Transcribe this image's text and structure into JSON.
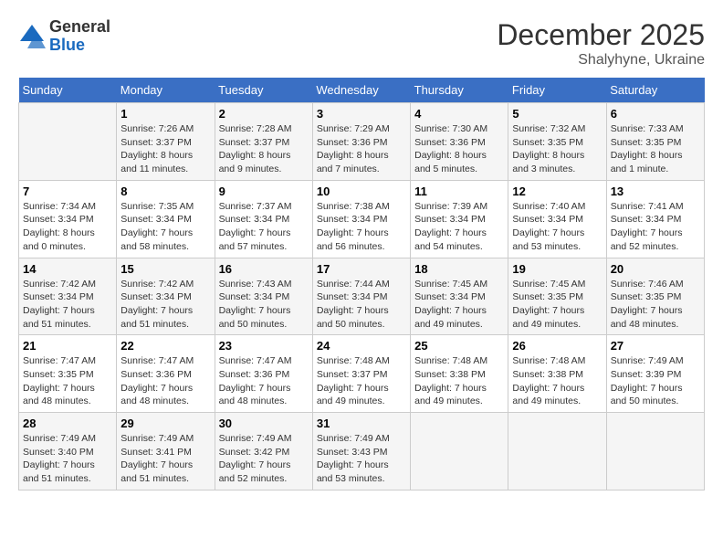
{
  "logo": {
    "general": "General",
    "blue": "Blue"
  },
  "header": {
    "month": "December 2025",
    "location": "Shalyhyne, Ukraine"
  },
  "weekdays": [
    "Sunday",
    "Monday",
    "Tuesday",
    "Wednesday",
    "Thursday",
    "Friday",
    "Saturday"
  ],
  "weeks": [
    [
      {
        "day": "",
        "sunrise": "",
        "sunset": "",
        "daylight": ""
      },
      {
        "day": "1",
        "sunrise": "Sunrise: 7:26 AM",
        "sunset": "Sunset: 3:37 PM",
        "daylight": "Daylight: 8 hours and 11 minutes."
      },
      {
        "day": "2",
        "sunrise": "Sunrise: 7:28 AM",
        "sunset": "Sunset: 3:37 PM",
        "daylight": "Daylight: 8 hours and 9 minutes."
      },
      {
        "day": "3",
        "sunrise": "Sunrise: 7:29 AM",
        "sunset": "Sunset: 3:36 PM",
        "daylight": "Daylight: 8 hours and 7 minutes."
      },
      {
        "day": "4",
        "sunrise": "Sunrise: 7:30 AM",
        "sunset": "Sunset: 3:36 PM",
        "daylight": "Daylight: 8 hours and 5 minutes."
      },
      {
        "day": "5",
        "sunrise": "Sunrise: 7:32 AM",
        "sunset": "Sunset: 3:35 PM",
        "daylight": "Daylight: 8 hours and 3 minutes."
      },
      {
        "day": "6",
        "sunrise": "Sunrise: 7:33 AM",
        "sunset": "Sunset: 3:35 PM",
        "daylight": "Daylight: 8 hours and 1 minute."
      }
    ],
    [
      {
        "day": "7",
        "sunrise": "Sunrise: 7:34 AM",
        "sunset": "Sunset: 3:34 PM",
        "daylight": "Daylight: 8 hours and 0 minutes."
      },
      {
        "day": "8",
        "sunrise": "Sunrise: 7:35 AM",
        "sunset": "Sunset: 3:34 PM",
        "daylight": "Daylight: 7 hours and 58 minutes."
      },
      {
        "day": "9",
        "sunrise": "Sunrise: 7:37 AM",
        "sunset": "Sunset: 3:34 PM",
        "daylight": "Daylight: 7 hours and 57 minutes."
      },
      {
        "day": "10",
        "sunrise": "Sunrise: 7:38 AM",
        "sunset": "Sunset: 3:34 PM",
        "daylight": "Daylight: 7 hours and 56 minutes."
      },
      {
        "day": "11",
        "sunrise": "Sunrise: 7:39 AM",
        "sunset": "Sunset: 3:34 PM",
        "daylight": "Daylight: 7 hours and 54 minutes."
      },
      {
        "day": "12",
        "sunrise": "Sunrise: 7:40 AM",
        "sunset": "Sunset: 3:34 PM",
        "daylight": "Daylight: 7 hours and 53 minutes."
      },
      {
        "day": "13",
        "sunrise": "Sunrise: 7:41 AM",
        "sunset": "Sunset: 3:34 PM",
        "daylight": "Daylight: 7 hours and 52 minutes."
      }
    ],
    [
      {
        "day": "14",
        "sunrise": "Sunrise: 7:42 AM",
        "sunset": "Sunset: 3:34 PM",
        "daylight": "Daylight: 7 hours and 51 minutes."
      },
      {
        "day": "15",
        "sunrise": "Sunrise: 7:42 AM",
        "sunset": "Sunset: 3:34 PM",
        "daylight": "Daylight: 7 hours and 51 minutes."
      },
      {
        "day": "16",
        "sunrise": "Sunrise: 7:43 AM",
        "sunset": "Sunset: 3:34 PM",
        "daylight": "Daylight: 7 hours and 50 minutes."
      },
      {
        "day": "17",
        "sunrise": "Sunrise: 7:44 AM",
        "sunset": "Sunset: 3:34 PM",
        "daylight": "Daylight: 7 hours and 50 minutes."
      },
      {
        "day": "18",
        "sunrise": "Sunrise: 7:45 AM",
        "sunset": "Sunset: 3:34 PM",
        "daylight": "Daylight: 7 hours and 49 minutes."
      },
      {
        "day": "19",
        "sunrise": "Sunrise: 7:45 AM",
        "sunset": "Sunset: 3:35 PM",
        "daylight": "Daylight: 7 hours and 49 minutes."
      },
      {
        "day": "20",
        "sunrise": "Sunrise: 7:46 AM",
        "sunset": "Sunset: 3:35 PM",
        "daylight": "Daylight: 7 hours and 48 minutes."
      }
    ],
    [
      {
        "day": "21",
        "sunrise": "Sunrise: 7:47 AM",
        "sunset": "Sunset: 3:35 PM",
        "daylight": "Daylight: 7 hours and 48 minutes."
      },
      {
        "day": "22",
        "sunrise": "Sunrise: 7:47 AM",
        "sunset": "Sunset: 3:36 PM",
        "daylight": "Daylight: 7 hours and 48 minutes."
      },
      {
        "day": "23",
        "sunrise": "Sunrise: 7:47 AM",
        "sunset": "Sunset: 3:36 PM",
        "daylight": "Daylight: 7 hours and 48 minutes."
      },
      {
        "day": "24",
        "sunrise": "Sunrise: 7:48 AM",
        "sunset": "Sunset: 3:37 PM",
        "daylight": "Daylight: 7 hours and 49 minutes."
      },
      {
        "day": "25",
        "sunrise": "Sunrise: 7:48 AM",
        "sunset": "Sunset: 3:38 PM",
        "daylight": "Daylight: 7 hours and 49 minutes."
      },
      {
        "day": "26",
        "sunrise": "Sunrise: 7:48 AM",
        "sunset": "Sunset: 3:38 PM",
        "daylight": "Daylight: 7 hours and 49 minutes."
      },
      {
        "day": "27",
        "sunrise": "Sunrise: 7:49 AM",
        "sunset": "Sunset: 3:39 PM",
        "daylight": "Daylight: 7 hours and 50 minutes."
      }
    ],
    [
      {
        "day": "28",
        "sunrise": "Sunrise: 7:49 AM",
        "sunset": "Sunset: 3:40 PM",
        "daylight": "Daylight: 7 hours and 51 minutes."
      },
      {
        "day": "29",
        "sunrise": "Sunrise: 7:49 AM",
        "sunset": "Sunset: 3:41 PM",
        "daylight": "Daylight: 7 hours and 51 minutes."
      },
      {
        "day": "30",
        "sunrise": "Sunrise: 7:49 AM",
        "sunset": "Sunset: 3:42 PM",
        "daylight": "Daylight: 7 hours and 52 minutes."
      },
      {
        "day": "31",
        "sunrise": "Sunrise: 7:49 AM",
        "sunset": "Sunset: 3:43 PM",
        "daylight": "Daylight: 7 hours and 53 minutes."
      },
      {
        "day": "",
        "sunrise": "",
        "sunset": "",
        "daylight": ""
      },
      {
        "day": "",
        "sunrise": "",
        "sunset": "",
        "daylight": ""
      },
      {
        "day": "",
        "sunrise": "",
        "sunset": "",
        "daylight": ""
      }
    ]
  ]
}
